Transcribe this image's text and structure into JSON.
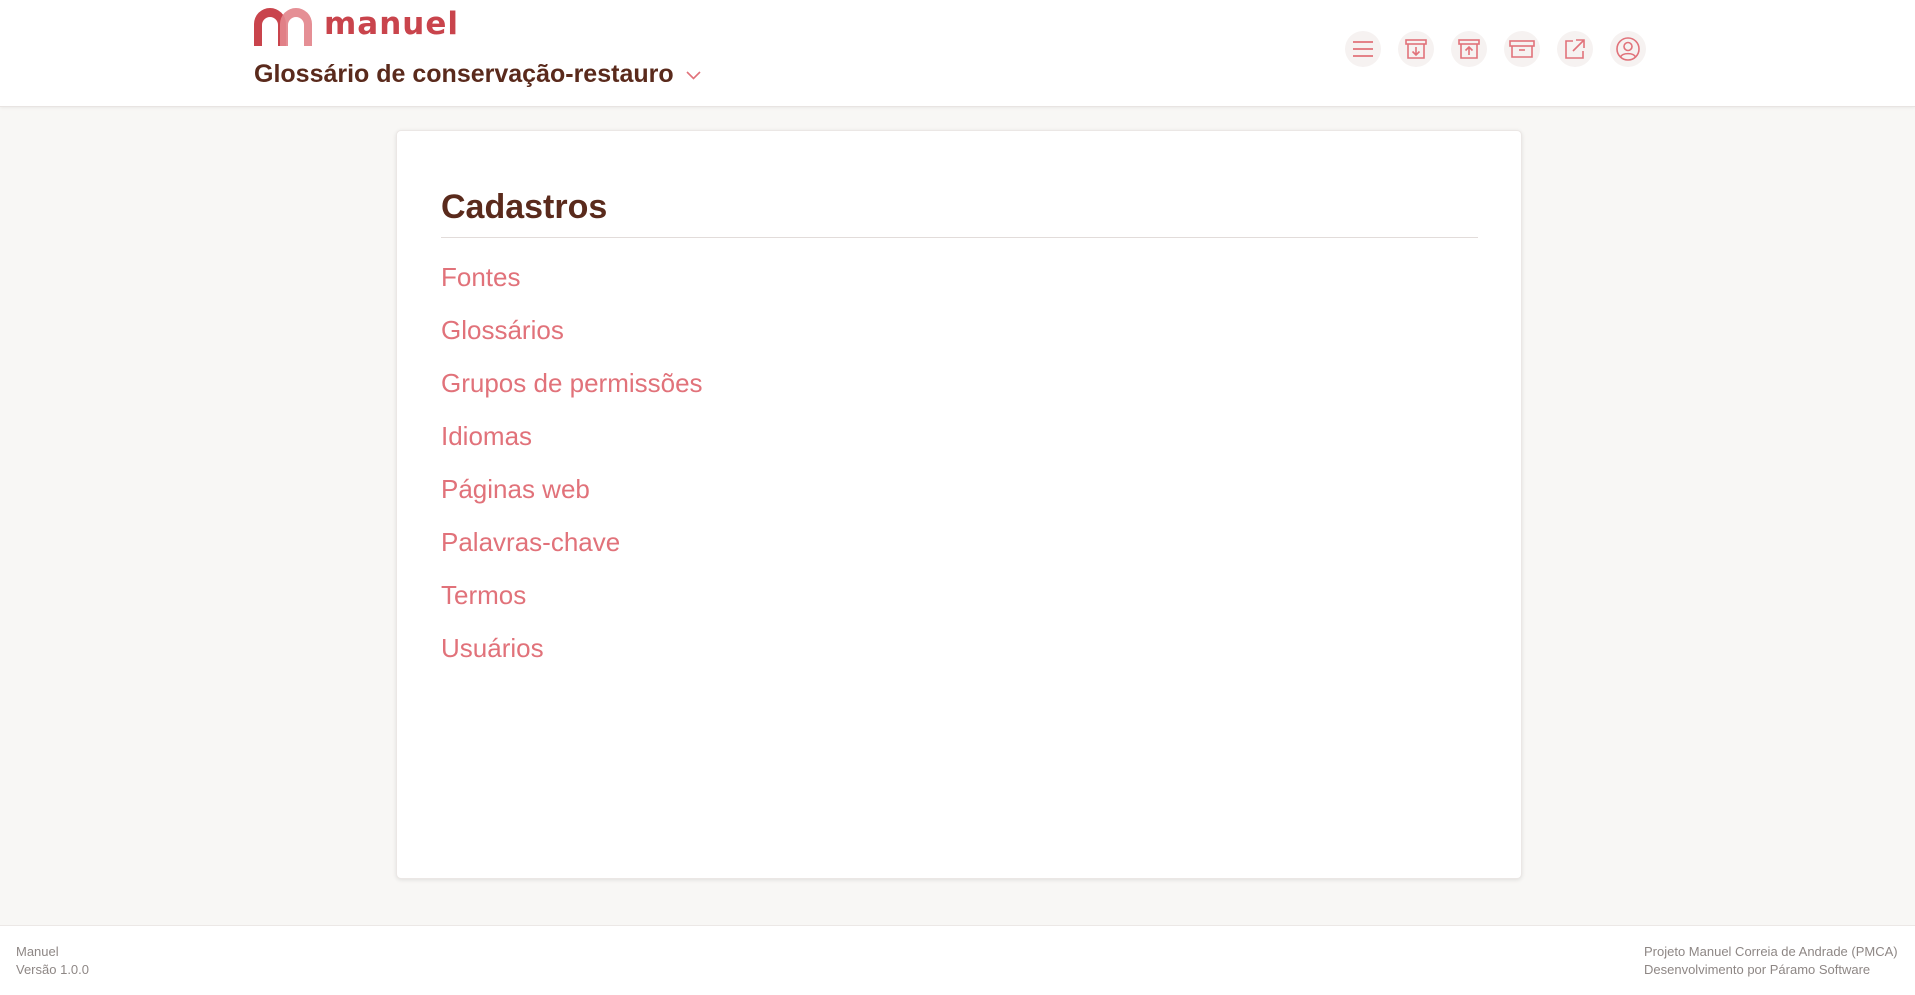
{
  "brand": {
    "name": "manuel",
    "accent": "#c9444c",
    "accent_light": "#e3868c"
  },
  "glossary": {
    "title": "Glossário de conservação-restauro"
  },
  "toolbar": [
    {
      "name": "menu-icon"
    },
    {
      "name": "import-icon"
    },
    {
      "name": "export-icon"
    },
    {
      "name": "archive-icon"
    },
    {
      "name": "external-link-icon"
    },
    {
      "name": "user-account-icon"
    }
  ],
  "main": {
    "title": "Cadastros",
    "links": [
      "Fontes",
      "Glossários",
      "Grupos de permissões",
      "Idiomas",
      "Páginas web",
      "Palavras-chave",
      "Termos",
      "Usuários"
    ]
  },
  "footer": {
    "app_name": "Manuel",
    "version": "Versão 1.0.0",
    "project": "Projeto Manuel Correia de Andrade (PMCA)",
    "developer": "Desenvolvimento por Páramo Software"
  },
  "colors": {
    "title": "#5a2a1c",
    "link": "#e1727a",
    "background": "#f8f7f5"
  }
}
